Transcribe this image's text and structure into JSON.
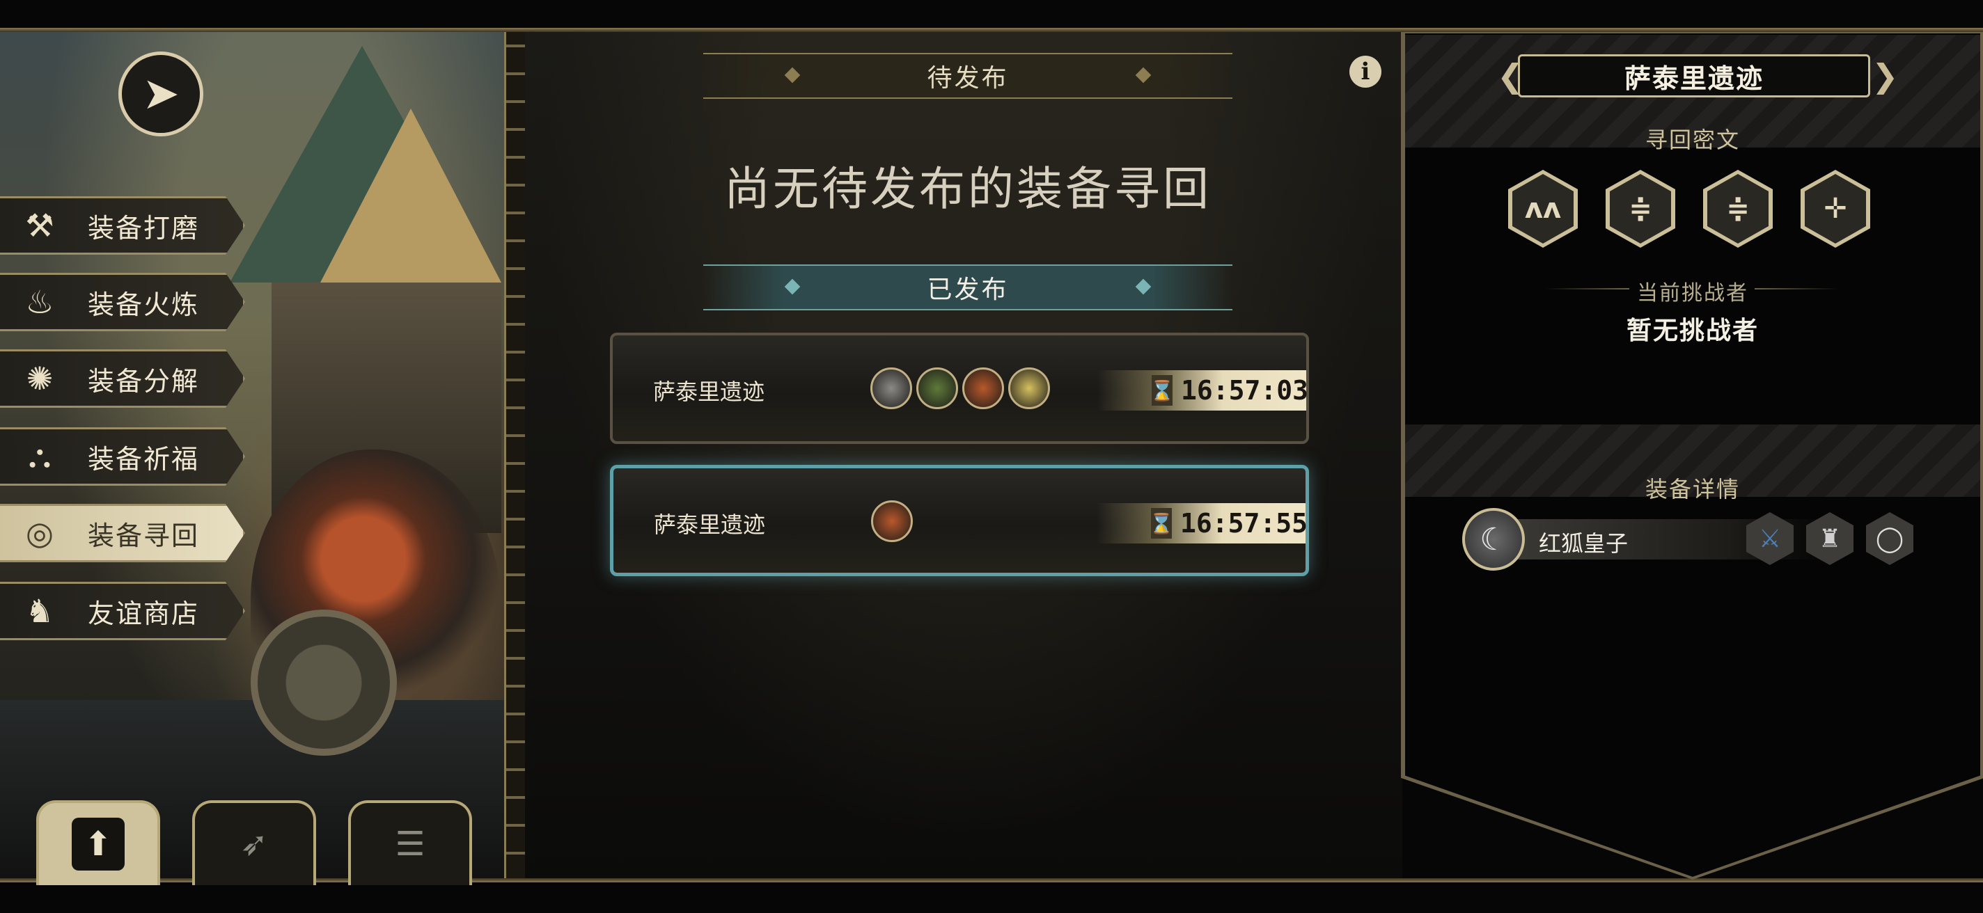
{
  "menu": {
    "items": [
      {
        "label": "装备打磨",
        "icon": "hammer-icon",
        "glyph": "⚒"
      },
      {
        "label": "装备火炼",
        "icon": "flame-icon",
        "glyph": "♨"
      },
      {
        "label": "装备分解",
        "icon": "dismantle-icon",
        "glyph": "✺"
      },
      {
        "label": "装备祈福",
        "icon": "pray-hands-icon",
        "glyph": "⛬"
      },
      {
        "label": "装备寻回",
        "icon": "target-icon",
        "glyph": "◎"
      },
      {
        "label": "友谊商店",
        "icon": "fox-icon",
        "glyph": "♞"
      }
    ],
    "active_index": 4
  },
  "bottom_buttons": [
    {
      "icon": "upload-icon",
      "glyph": "⬆",
      "active": true
    },
    {
      "icon": "feather-icon",
      "glyph": "➶",
      "active": false
    },
    {
      "icon": "list-icon",
      "glyph": "☰",
      "active": false
    }
  ],
  "pending": {
    "title": "待发布",
    "empty_message": "尚无待发布的装备寻回"
  },
  "published": {
    "title": "已发布",
    "entries": [
      {
        "name": "萨泰里遗迹",
        "time": "16:57:03",
        "avatars": [
          "gray",
          "green",
          "orange",
          "bw"
        ],
        "active": false
      },
      {
        "name": "萨泰里遗迹",
        "time": "16:57:55",
        "avatars": [
          "orange"
        ],
        "active": true
      }
    ]
  },
  "info_label": "i",
  "detail": {
    "location": "萨泰里遗迹",
    "cipher_title": "寻回密文",
    "runes": [
      "ʌʌ",
      "≑",
      "≑",
      "✛"
    ],
    "challenger_label": "当前挑战者",
    "challenger_value": "暂无挑战者",
    "equipment_title": "装备详情",
    "equipment_name": "红狐皇子",
    "equipment_slots": [
      {
        "icon": "sword-icon",
        "glyph": "⚔",
        "color": "#4a7fb8"
      },
      {
        "icon": "armor-icon",
        "glyph": "♜",
        "color": "#d0d0d0"
      },
      {
        "icon": "ring-icon",
        "glyph": "◯",
        "color": "#e0e0e0"
      }
    ]
  },
  "colors": {
    "accent_gold": "#c8bc96",
    "accent_teal": "#5f9fa8",
    "avatar_gray": "#8a8a86",
    "avatar_green": "#5e7a3a",
    "avatar_orange": "#b9582b",
    "avatar_bw": "#d6c060"
  }
}
